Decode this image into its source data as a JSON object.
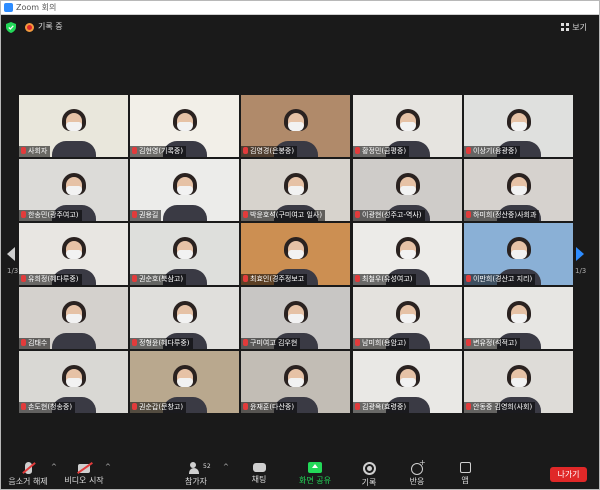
{
  "window": {
    "title": "Zoom 회의"
  },
  "topbar": {
    "recording_label": "기록 중",
    "view_label": "보기"
  },
  "pagination": {
    "left": "1/3",
    "right": "1/3"
  },
  "participants": [
    {
      "name": "사회자",
      "active": true,
      "bg": "#e9e7dc"
    },
    {
      "name": "김현영(기록중)",
      "bg": "#f2efe8"
    },
    {
      "name": "김영경(은봉중)",
      "bg": "#b08a6a"
    },
    {
      "name": "황정민(금평중)",
      "bg": "#e6e4e0"
    },
    {
      "name": "이상기(융광중)",
      "bg": "#dfe0de"
    },
    {
      "name": "한송민(광주여고)",
      "bg": "#dcdbd8"
    },
    {
      "name": "권용길",
      "bg": "#ececea"
    },
    {
      "name": "박윤호석(구미여고 일사)",
      "bg": "#d7d3cd"
    },
    {
      "name": "이광현(성주고-역사)",
      "bg": "#cfccc9"
    },
    {
      "name": "하미희(정산중)사회과",
      "bg": "#d6d2ce"
    },
    {
      "name": "유희정(혜다루중)",
      "bg": "#e8e6e2"
    },
    {
      "name": "권순호(북삼고)",
      "bg": "#dedfdc"
    },
    {
      "name": "최효인(경주정보고",
      "bg": "#cc8f52"
    },
    {
      "name": "최철우(유성여고)",
      "bg": "#ecebe8"
    },
    {
      "name": "이만희(경산고 지리)",
      "bg": "#8ab0d6"
    },
    {
      "name": "김태수",
      "bg": "#d4d1cd"
    },
    {
      "name": "정형윤(혜다루중)",
      "bg": "#e0dfdc"
    },
    {
      "name": "구미여고 김우현",
      "bg": "#c8c6c4"
    },
    {
      "name": "남미희(용암고)",
      "bg": "#e4e2de"
    },
    {
      "name": "변유정(석적고)",
      "bg": "#e7e6e3"
    },
    {
      "name": "손도현(청송중)",
      "bg": "#d9d8d4"
    },
    {
      "name": "권순갑(문창고)",
      "bg": "#b9a88e"
    },
    {
      "name": "윤재훈(다산중)",
      "bg": "#c2bdb5"
    },
    {
      "name": "김광옥(효령중)",
      "bg": "#e9e8e5"
    },
    {
      "name": "안동중 김영희(사회)",
      "bg": "#dedcd8"
    }
  ],
  "toolbar": {
    "mute_label": "음소거 해제",
    "video_label": "비디오 시작",
    "participants_label": "참가자",
    "participants_count": "52",
    "chat_label": "채팅",
    "share_label": "화면 공유",
    "record_label": "기록",
    "reactions_label": "반응",
    "apps_label": "앱",
    "leave_label": "나가기"
  },
  "colors": {
    "accent": "#2d8cff",
    "share_green": "#23d959",
    "leave_red": "#e02828"
  }
}
